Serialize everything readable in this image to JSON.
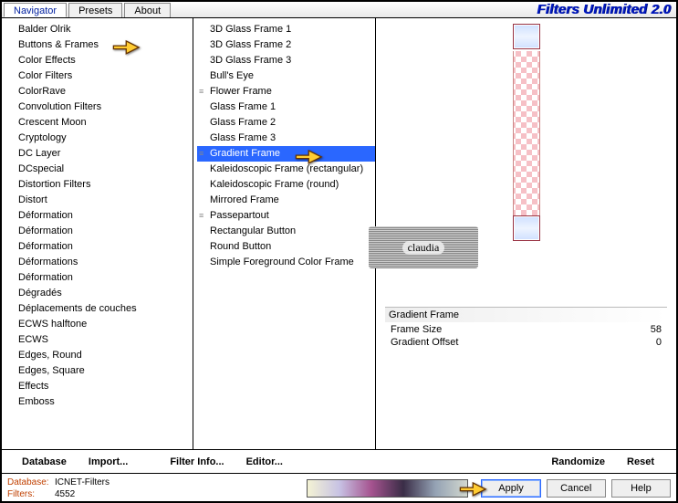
{
  "app": {
    "title": "Filters Unlimited 2.0"
  },
  "tabs": {
    "navigator": "Navigator",
    "presets": "Presets",
    "about": "About"
  },
  "categories": [
    "Balder Olrik",
    "Buttons & Frames",
    "Color Effects",
    "Color Filters",
    "ColorRave",
    "Convolution Filters",
    "Crescent Moon",
    "Cryptology",
    "DC Layer",
    "DCspecial",
    "Distortion Filters",
    "Distort",
    "Déformation",
    "Déformation",
    "Déformation",
    "Déformations",
    "Déformation",
    "Dégradés",
    "Déplacements de couches",
    "ECWS halftone",
    "ECWS",
    "Edges, Round",
    "Edges, Square",
    "Effects",
    "Emboss"
  ],
  "filters": [
    {
      "n": "3D Glass Frame 1",
      "m": 0
    },
    {
      "n": "3D Glass Frame 2",
      "m": 0
    },
    {
      "n": "3D Glass Frame 3",
      "m": 0
    },
    {
      "n": "Bull's Eye",
      "m": 0
    },
    {
      "n": "Flower Frame",
      "m": 1
    },
    {
      "n": "Glass Frame 1",
      "m": 0
    },
    {
      "n": "Glass Frame 2",
      "m": 0
    },
    {
      "n": "Glass Frame 3",
      "m": 0
    },
    {
      "n": "Gradient Frame",
      "m": 1
    },
    {
      "n": "Kaleidoscopic Frame (rectangular)",
      "m": 0
    },
    {
      "n": "Kaleidoscopic Frame (round)",
      "m": 0
    },
    {
      "n": "Mirrored Frame",
      "m": 0
    },
    {
      "n": "Passepartout",
      "m": 1
    },
    {
      "n": "Rectangular Button",
      "m": 0
    },
    {
      "n": "Round Button",
      "m": 0
    },
    {
      "n": "Simple Foreground Color Frame",
      "m": 0
    }
  ],
  "selected_filter_index": 8,
  "param_title": "Gradient Frame",
  "params": [
    {
      "label": "Frame Size",
      "value": "58"
    },
    {
      "label": "Gradient Offset",
      "value": "0"
    }
  ],
  "links": {
    "database": "Database",
    "import": "Import...",
    "filterinfo": "Filter Info...",
    "editor": "Editor...",
    "randomize": "Randomize",
    "reset": "Reset"
  },
  "buttons": {
    "apply": "Apply",
    "cancel": "Cancel",
    "help": "Help"
  },
  "status": {
    "db_label": "Database:",
    "db_value": "ICNET-Filters",
    "flt_label": "Filters:",
    "flt_value": "4552"
  },
  "watermark": "claudia"
}
